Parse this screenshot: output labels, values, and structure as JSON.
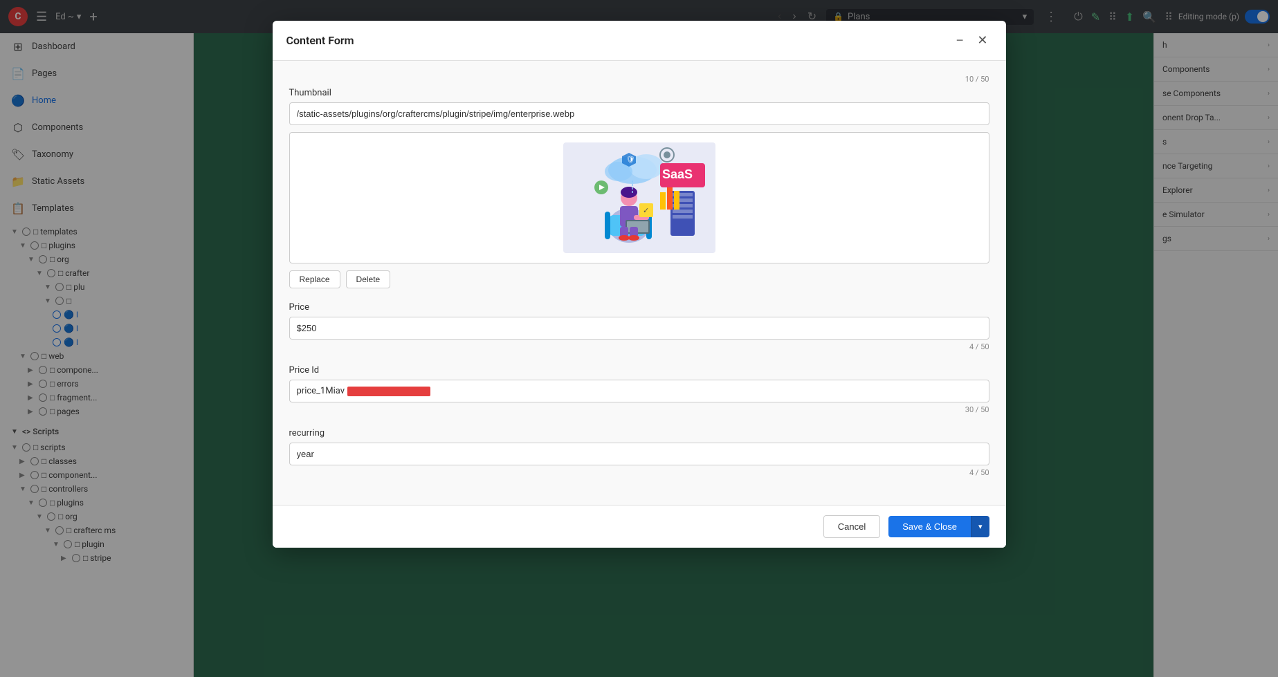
{
  "toolbar": {
    "logo_text": "C",
    "hamburger_icon": "☰",
    "user_label": "Ed ~",
    "plus_icon": "+",
    "back_icon": "‹",
    "forward_icon": "›",
    "refresh_icon": "↻",
    "address_bar": {
      "lock_icon": "🔒",
      "page_name": "Plans",
      "dropdown_icon": "▾"
    },
    "more_icon": "⋮",
    "power_icon": "⏻",
    "pencil_icon": "✎",
    "grid_icon": "⠿",
    "upload_icon": "⬆",
    "search_icon": "🔍",
    "apps_icon": "⠿",
    "editing_mode_label": "Editing mode (p)"
  },
  "sidebar": {
    "nav_items": [
      {
        "id": "dashboard",
        "icon": "⊞",
        "label": "Dashboard"
      },
      {
        "id": "pages",
        "icon": "📄",
        "label": "Pages"
      },
      {
        "id": "home",
        "icon": "🏠",
        "label": "Home",
        "active": true
      },
      {
        "id": "components",
        "icon": "⬡",
        "label": "Components"
      },
      {
        "id": "taxonomy",
        "icon": "🏷",
        "label": "Taxonomy"
      },
      {
        "id": "static-assets",
        "icon": "📁",
        "label": "Static Assets"
      },
      {
        "id": "templates",
        "icon": "📋",
        "label": "Templates"
      }
    ],
    "sections": [
      {
        "id": "templates-section",
        "label": "templates",
        "expanded": true,
        "indent": 0,
        "items": [
          {
            "label": "plugins",
            "indent": 1,
            "expanded": true,
            "type": "folder"
          },
          {
            "label": "org",
            "indent": 2,
            "expanded": true,
            "type": "folder"
          },
          {
            "label": "crafter",
            "indent": 3,
            "expanded": true,
            "type": "folder"
          },
          {
            "label": "plu",
            "indent": 4,
            "expanded": true,
            "type": "folder"
          },
          {
            "label": "",
            "indent": 5,
            "expanded": true,
            "type": "folder"
          },
          {
            "label": "I",
            "indent": 6,
            "type": "file",
            "blue": true
          },
          {
            "label": "I",
            "indent": 6,
            "type": "file",
            "blue": true
          },
          {
            "label": "I",
            "indent": 6,
            "type": "file",
            "blue": true
          }
        ]
      },
      {
        "id": "web-section",
        "label": "web",
        "indent": 1,
        "expanded": true,
        "items": [
          {
            "label": "compone",
            "indent": 2,
            "type": "folder"
          },
          {
            "label": "errors",
            "indent": 2,
            "type": "folder"
          },
          {
            "label": "fragment",
            "indent": 2,
            "type": "folder"
          },
          {
            "label": "pages",
            "indent": 2,
            "type": "folder"
          }
        ]
      }
    ],
    "scripts_section": {
      "label": "Scripts",
      "expanded": true,
      "items": [
        {
          "label": "scripts",
          "indent": 0,
          "type": "folder",
          "expanded": true
        },
        {
          "label": "classes",
          "indent": 1,
          "type": "folder"
        },
        {
          "label": "component",
          "indent": 1,
          "type": "folder"
        },
        {
          "label": "controllers",
          "indent": 1,
          "type": "folder"
        },
        {
          "label": "plugins",
          "indent": 2,
          "type": "folder",
          "expanded": true
        },
        {
          "label": "org",
          "indent": 3,
          "type": "folder",
          "expanded": true
        },
        {
          "label": "crafterc ms",
          "indent": 4,
          "type": "folder",
          "expanded": true
        },
        {
          "label": "plugin",
          "indent": 5,
          "type": "folder",
          "expanded": true
        },
        {
          "label": "stripe",
          "indent": 6,
          "type": "folder"
        }
      ]
    }
  },
  "right_panel": {
    "items": [
      {
        "label": "h",
        "chevron": "›"
      },
      {
        "label": "Components",
        "chevron": "›"
      },
      {
        "label": "se Components",
        "chevron": "›"
      },
      {
        "label": "onent Drop Ta...",
        "chevron": "›"
      },
      {
        "label": "s",
        "chevron": "›"
      },
      {
        "label": "nce Targeting",
        "chevron": "›"
      },
      {
        "label": "Explorer",
        "chevron": "›"
      },
      {
        "label": "e Simulator",
        "chevron": "›"
      },
      {
        "label": "gs",
        "chevron": "›"
      }
    ]
  },
  "modal": {
    "title": "Content Form",
    "minimize_icon": "−",
    "close_icon": "✕",
    "counter_top": "10 / 50",
    "thumbnail_label": "Thumbnail",
    "thumbnail_value": "/static-assets/plugins/org/craftercms/plugin/stripe/img/enterprise.webp",
    "replace_button": "Replace",
    "delete_button": "Delete",
    "price_label": "Price",
    "price_value": "$250",
    "price_counter": "4 / 50",
    "price_id_label": "Price Id",
    "price_id_visible": "price_1Miav",
    "price_id_counter": "30 / 50",
    "recurring_label": "recurring",
    "recurring_value": "year",
    "recurring_counter": "4 / 50",
    "cancel_button": "Cancel",
    "save_button": "Save & Close",
    "save_dropdown_icon": "▾"
  }
}
